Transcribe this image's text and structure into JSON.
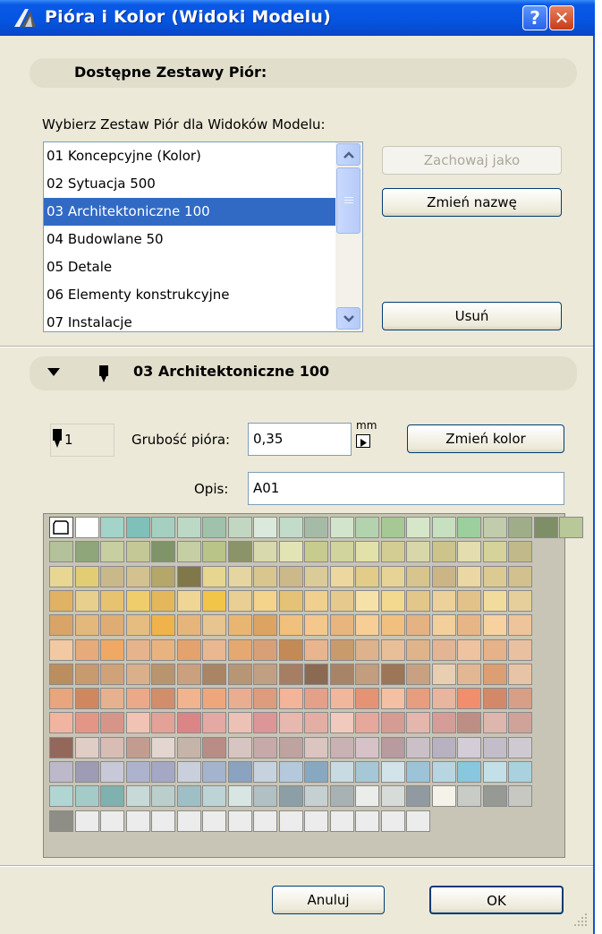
{
  "window": {
    "title": "Pióra i Kolor (Widoki Modelu)",
    "help_glyph": "?",
    "close_glyph": "✕"
  },
  "section_available": {
    "title": "Dostępne Zestawy Piór:"
  },
  "choose_label": "Wybierz Zestaw Piór dla Widoków Modelu:",
  "pen_sets": [
    "01 Koncepcyjne (Kolor)",
    "02 Sytuacja 500",
    "03 Architektoniczne 100",
    "04 Budowlane 50",
    "05 Detale",
    "06 Elementy konstrukcyjne",
    "07 Instalacje"
  ],
  "selected_index": 2,
  "buttons": {
    "save_as": "Zachowaj jako",
    "rename": "Zmień nazwę",
    "delete": "Usuń",
    "change_color": "Zmień kolor",
    "cancel": "Anuluj",
    "ok": "OK"
  },
  "section_current": {
    "title": "03 Architektoniczne 100"
  },
  "pen": {
    "number": "1",
    "thickness_label": "Grubość pióra:",
    "thickness_value": "0,35",
    "unit": "mm",
    "description_label": "Opis:",
    "description_value": "A01"
  },
  "palette": {
    "cols": 19,
    "rows": [
      [
        "special",
        "#ffffff",
        "#a3d3c9",
        "#7fc0b8",
        "#a5cfc1",
        "#bcd9c6",
        "#a0c2ac",
        "#c1d7c2",
        "#dae9dc",
        "#c2dcc9",
        "#a5bba7",
        "#d2e5cc",
        "#b2d3ae",
        "#a6c895",
        "#d6e6c8",
        "#c7e0bf",
        "#9ccf9d",
        "#c0ccab",
        "#9fae88",
        "#7e8f68",
        "#b8c898"
      ],
      [
        "#b3c29a",
        "#8ea679",
        "#c7cfa0",
        "#c4c897",
        "#7f9468",
        "#c5cfa3",
        "#b8c488",
        "#8b9468",
        "#d8d9ac",
        "#e2e4b4",
        "#c7cc8e",
        "#d1d49c",
        "#e3e1aa",
        "#d3cc93",
        "#d8d7aa",
        "#ccc48b",
        "#e3ddb0",
        "#d6d29c",
        "#c2b98a"
      ],
      [
        "#e7d793",
        "#e2cd74",
        "#c9b98a",
        "#d3c190",
        "#b5a66a",
        "#807848",
        "#e7d68f",
        "#e5d5a0",
        "#d8c68e",
        "#cbb98a",
        "#dbcb98",
        "#ecd79f",
        "#e3cc8a",
        "#e7d396",
        "#d7c58d",
        "#cbb587",
        "#ebd7a3",
        "#dcca93",
        "#d2c08e"
      ],
      [
        "#dfb264",
        "#e8cf8e",
        "#e7c270",
        "#f0cd6b",
        "#e4b85a",
        "#efd596",
        "#f0c548",
        "#e9cf93",
        "#f4d48a",
        "#e4c377",
        "#f0cf8f",
        "#e6c98c",
        "#f6e2a8",
        "#f2d98f",
        "#e2c68a",
        "#ecd29a",
        "#e3c28a",
        "#f2dc9d",
        "#e6cf9a"
      ],
      [
        "#d8a467",
        "#e3b87d",
        "#dfad73",
        "#e6bd80",
        "#f0b24a",
        "#e6b57b",
        "#e8c490",
        "#e9b672",
        "#dca460",
        "#f0c07c",
        "#f4c78c",
        "#e8b57e",
        "#f7ce96",
        "#f1c07e",
        "#e5b283",
        "#f3cf9b",
        "#e8b686",
        "#f7d2a0",
        "#eec49a"
      ],
      [
        "#f3c9a3",
        "#e7ab79",
        "#f0a865",
        "#e6b48c",
        "#e9b37f",
        "#e4a26c",
        "#eab890",
        "#e5a870",
        "#d7a076",
        "#c48a55",
        "#e9b58e",
        "#c99a6a",
        "#ddb28c",
        "#e8bf99",
        "#e0b48b",
        "#e3b594",
        "#efc2a0",
        "#e6b28a",
        "#e9c0a0"
      ],
      [
        "#bb8e5f",
        "#c79a70",
        "#cfa27a",
        "#d9b08b",
        "#b8956e",
        "#caa07f",
        "#a98565",
        "#b69675",
        "#c19f83",
        "#a57e63",
        "#8a6a52",
        "#a88466",
        "#c29d7e",
        "#9d7557",
        "#c8a182",
        "#e9cfb2",
        "#e2b894",
        "#db9f73",
        "#e8c4a6"
      ],
      [
        "#e8a57e",
        "#d08760",
        "#e6b18f",
        "#eba98a",
        "#d28d6a",
        "#f2b38f",
        "#f0a67d",
        "#e9ae92",
        "#dd9c7e",
        "#f3b49a",
        "#e4a089",
        "#f0b79d",
        "#e59374",
        "#f4c0a3",
        "#e89d80",
        "#e8b59f",
        "#f08e6e",
        "#d4886a",
        "#d79f86"
      ],
      [
        "#f1b4a1",
        "#e49686",
        "#d7958a",
        "#f0c3b5",
        "#e3a198",
        "#dc8587",
        "#e5a9a3",
        "#ecc2b7",
        "#dd9597",
        "#e7b8b0",
        "#e3aea3",
        "#f1c9bd",
        "#e6a89c",
        "#d49c93",
        "#e3b6ae",
        "#d59d97",
        "#bd8f84",
        "#ddb6ad",
        "#cfa39a"
      ],
      [
        "#93685b",
        "#e0cdc6",
        "#d8bdb4",
        "#c39c90",
        "#e3d5cf",
        "#c7b4a9",
        "#b98c86",
        "#d6c5c1",
        "#c6a9a8",
        "#bfa3a0",
        "#dcc4c1",
        "#c9b1b4",
        "#d7c2c8",
        "#b89b9f",
        "#cbc0c7",
        "#b8b1c1",
        "#d4ccd6",
        "#c2bdc8",
        "#cfcad2"
      ],
      [
        "#bdb9cb",
        "#9e9cb5",
        "#c8c9d8",
        "#aeb3cd",
        "#a5a8c4",
        "#c9d0dc",
        "#a4b4cd",
        "#8aa3c0",
        "#c6d2de",
        "#b4c9db",
        "#88a8c2",
        "#c8dbe3",
        "#a6c7d6",
        "#d3e3ea",
        "#9cc3d7",
        "#b7d6e2",
        "#88c7dd",
        "#c3e0e8",
        "#a9d1de"
      ],
      [
        "#b0d6d3",
        "#a3ccc9",
        "#7fb2ae",
        "#c7dad7",
        "#bacfcc",
        "#9fbfc6",
        "#bdd4d6",
        "#d7e5e3",
        "#b1c0c2",
        "#8d9fa6",
        "#c5d0d3",
        "#a8b2b5",
        "#ebedeb",
        "#d8dcd8",
        "#909aa0",
        "#f5f3e9",
        "#c9ccc6",
        "#969994",
        "#c8c8c2"
      ],
      [
        "#8f8e86",
        "#ececec",
        "#ececec",
        "#ececec",
        "#ececec",
        "#ececec",
        "#ececec",
        "#ececec",
        "#ececec",
        "#ececec",
        "#ececec",
        "#ececec",
        "#ececec",
        "#ececec",
        "#ececec"
      ]
    ]
  }
}
